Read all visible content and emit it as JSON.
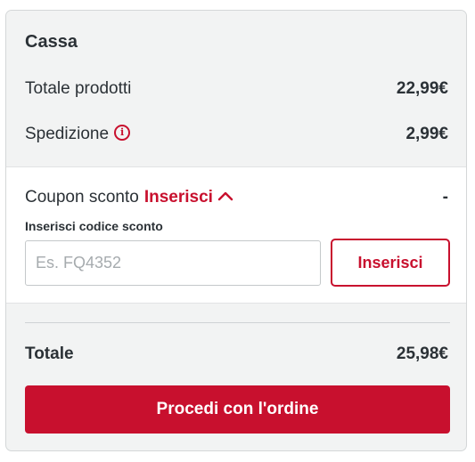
{
  "checkout": {
    "title": "Cassa",
    "products_total_label": "Totale prodotti",
    "products_total_value": "22,99€",
    "shipping_label": "Spedizione",
    "shipping_value": "2,99€",
    "coupon": {
      "label": "Coupon sconto",
      "link": "Inserisci",
      "value": "-",
      "code_label": "Inserisci codice sconto",
      "input_value": "",
      "input_placeholder": "Es. FQ4352",
      "apply_button": "Inserisci"
    },
    "total_label": "Totale",
    "total_value": "25,98€",
    "proceed_button": "Procedi con l'ordine"
  },
  "colors": {
    "accent": "#c8102e",
    "text": "#2b3136",
    "panel_bg": "#f2f3f3"
  },
  "icons": {
    "shipping_info": "info-icon",
    "coupon_toggle": "chevron-up-icon"
  }
}
